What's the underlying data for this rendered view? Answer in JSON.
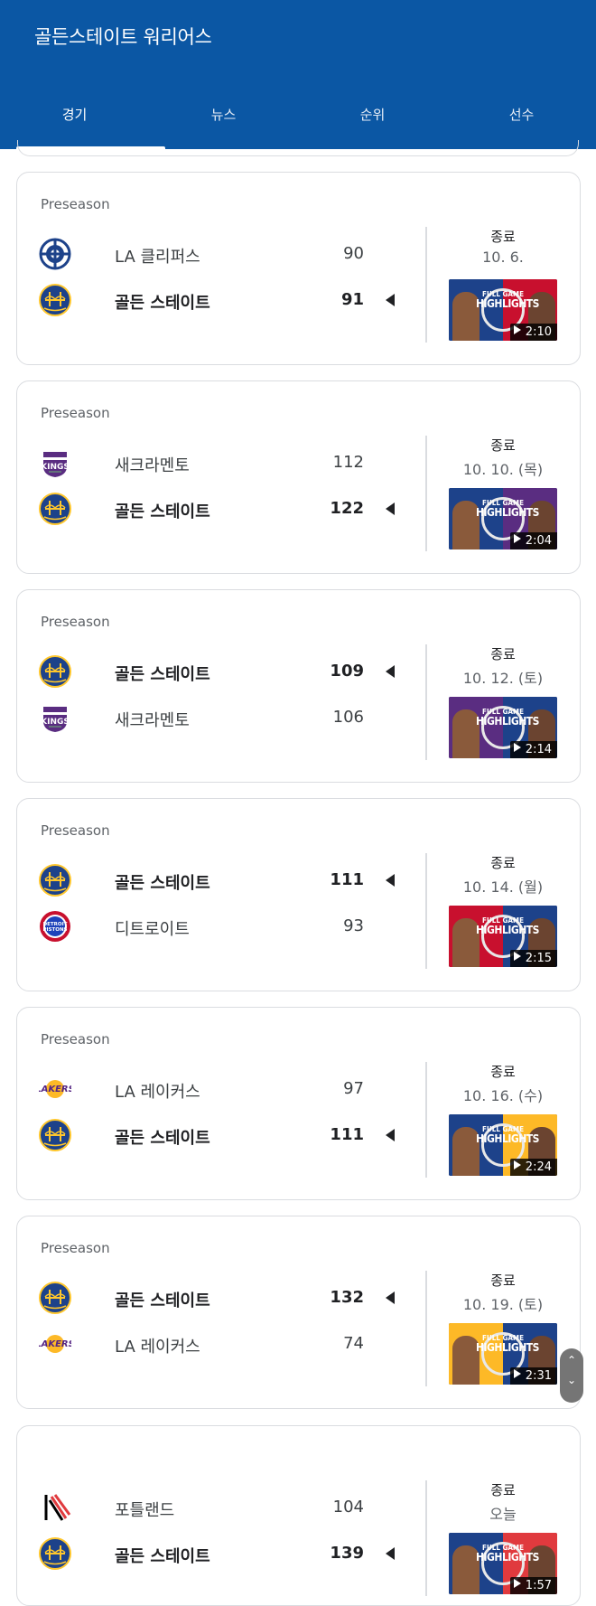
{
  "header": {
    "title": "골든스테이트 워리어스",
    "tabs": [
      {
        "label": "경기",
        "active": true
      },
      {
        "label": "뉴스",
        "active": false
      },
      {
        "label": "순위",
        "active": false
      },
      {
        "label": "선수",
        "active": false
      }
    ],
    "background_color": "#0b57a4"
  },
  "games": [
    {
      "season": "Preseason",
      "teams": [
        {
          "name": "LA 클리퍼스",
          "score": "90",
          "logo": "clippers-logo",
          "winner": false
        },
        {
          "name": "골든 스테이트",
          "score": "91",
          "logo": "warriors-logo",
          "winner": true
        }
      ],
      "status": "종료",
      "date": "10. 6.",
      "video": {
        "title_small": "FULL GAME",
        "title_big": "HIGHLIGHTS",
        "duration": "2:10"
      }
    },
    {
      "season": "Preseason",
      "teams": [
        {
          "name": "새크라멘토",
          "score": "112",
          "logo": "kings-logo",
          "winner": false
        },
        {
          "name": "골든 스테이트",
          "score": "122",
          "logo": "warriors-logo",
          "winner": true
        }
      ],
      "status": "종료",
      "date": "10. 10. (목)",
      "video": {
        "title_small": "FULL GAME",
        "title_big": "HIGHLIGHTS",
        "duration": "2:04"
      }
    },
    {
      "season": "Preseason",
      "teams": [
        {
          "name": "골든 스테이트",
          "score": "109",
          "logo": "warriors-logo",
          "winner": true
        },
        {
          "name": "새크라멘토",
          "score": "106",
          "logo": "kings-logo",
          "winner": false
        }
      ],
      "status": "종료",
      "date": "10. 12. (토)",
      "video": {
        "title_small": "FULL GAME",
        "title_big": "HIGHLIGHTS",
        "duration": "2:14"
      }
    },
    {
      "season": "Preseason",
      "teams": [
        {
          "name": "골든 스테이트",
          "score": "111",
          "logo": "warriors-logo",
          "winner": true
        },
        {
          "name": "디트로이트",
          "score": "93",
          "logo": "pistons-logo",
          "winner": false
        }
      ],
      "status": "종료",
      "date": "10. 14. (월)",
      "video": {
        "title_small": "FULL GAME",
        "title_big": "HIGHLIGHTS",
        "duration": "2:15"
      }
    },
    {
      "season": "Preseason",
      "teams": [
        {
          "name": "LA 레이커스",
          "score": "97",
          "logo": "lakers-logo",
          "winner": false
        },
        {
          "name": "골든 스테이트",
          "score": "111",
          "logo": "warriors-logo",
          "winner": true
        }
      ],
      "status": "종료",
      "date": "10. 16. (수)",
      "video": {
        "title_small": "FULL GAME",
        "title_big": "HIGHLIGHTS",
        "duration": "2:24"
      }
    },
    {
      "season": "Preseason",
      "teams": [
        {
          "name": "골든 스테이트",
          "score": "132",
          "logo": "warriors-logo",
          "winner": true
        },
        {
          "name": "LA 레이커스",
          "score": "74",
          "logo": "lakers-logo",
          "winner": false
        }
      ],
      "status": "종료",
      "date": "10. 19. (토)",
      "video": {
        "title_small": "FULL GAME",
        "title_big": "HIGHLIGHTS",
        "duration": "2:31"
      }
    },
    {
      "season": "",
      "teams": [
        {
          "name": "포틀랜드",
          "score": "104",
          "logo": "blazers-logo",
          "winner": false
        },
        {
          "name": "골든 스테이트",
          "score": "139",
          "logo": "warriors-logo",
          "winner": true
        }
      ],
      "status": "종료",
      "date": "오늘",
      "video": {
        "title_small": "FULL GAME",
        "title_big": "HIGHLIGHTS",
        "duration": "1:57"
      }
    }
  ],
  "scroll_control": {
    "up_icon": "chevron-up-icon",
    "down_icon": "chevron-down-icon"
  }
}
